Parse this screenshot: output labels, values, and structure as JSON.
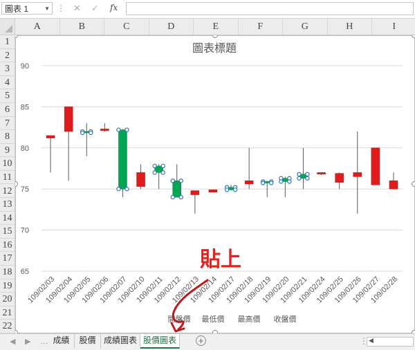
{
  "formula_bar": {
    "name_box": "圖表 1",
    "dots": "⋮",
    "cancel_icon": "✕",
    "enter_icon": "✓",
    "fx_label": "fx",
    "formula": ""
  },
  "columns": [
    "A",
    "B",
    "C",
    "D",
    "E",
    "F",
    "G",
    "H",
    "I"
  ],
  "rows": [
    "1",
    "2",
    "3",
    "4",
    "5",
    "6",
    "7",
    "8",
    "9",
    "10",
    "11",
    "12",
    "13",
    "14",
    "15",
    "16",
    "17",
    "18",
    "19",
    "20",
    "21",
    "22"
  ],
  "sheet_tabs": [
    {
      "label": "成績",
      "active": false
    },
    {
      "label": "股價",
      "active": false
    },
    {
      "label": "成績圖表",
      "active": false
    },
    {
      "label": "股價圖表",
      "active": true
    }
  ],
  "add_sheet_label": "+",
  "annotation": {
    "text": "貼上",
    "color": "#e8201b",
    "arrow_color": "#c0171c"
  },
  "chart_data": {
    "type": "candlestick",
    "title": "圖表標題",
    "ylim": [
      65,
      90
    ],
    "y_ticks": [
      65,
      70,
      75,
      80,
      85,
      90
    ],
    "grid": true,
    "legend_position": "bottom",
    "legend": [
      "開盤價",
      "最低價",
      "最高價",
      "收盤價"
    ],
    "up_color": "#00a651",
    "down_color": "#e31a1c",
    "categories": [
      "109/02/03",
      "109/02/04",
      "109/02/05",
      "109/02/06",
      "109/02/07",
      "109/02/10",
      "109/02/11",
      "109/02/12",
      "109/02/13",
      "109/02/14",
      "109/02/17",
      "109/02/18",
      "109/02/19",
      "109/02/20",
      "109/02/21",
      "109/02/24",
      "109/02/25",
      "109/02/26",
      "109/02/27",
      "109/02/28"
    ],
    "open": [
      81.5,
      85.0,
      82.0,
      82.3,
      75.0,
      77.0,
      77.0,
      74.0,
      74.8,
      74.9,
      74.9,
      76.0,
      75.8,
      75.9,
      76.3,
      77.0,
      76.9,
      77.0,
      80.0,
      76.0
    ],
    "high": [
      81.5,
      85.0,
      83.0,
      83.0,
      82.3,
      78.0,
      78.0,
      78.0,
      74.8,
      74.9,
      75.5,
      80.0,
      76.0,
      76.5,
      80.0,
      77.0,
      77.0,
      82.0,
      80.0,
      77.0
    ],
    "low": [
      77.0,
      76.0,
      79.0,
      82.0,
      74.0,
      75.0,
      75.0,
      74.0,
      72.0,
      74.6,
      74.8,
      75.0,
      74.0,
      74.0,
      75.0,
      76.7,
      75.0,
      72.0,
      75.5,
      75.0
    ],
    "close": [
      81.2,
      82.0,
      82.0,
      82.1,
      82.2,
      75.3,
      77.8,
      76.0,
      74.3,
      74.6,
      75.2,
      75.6,
      75.9,
      76.3,
      76.8,
      76.8,
      75.8,
      76.5,
      75.5,
      75.0
    ]
  }
}
